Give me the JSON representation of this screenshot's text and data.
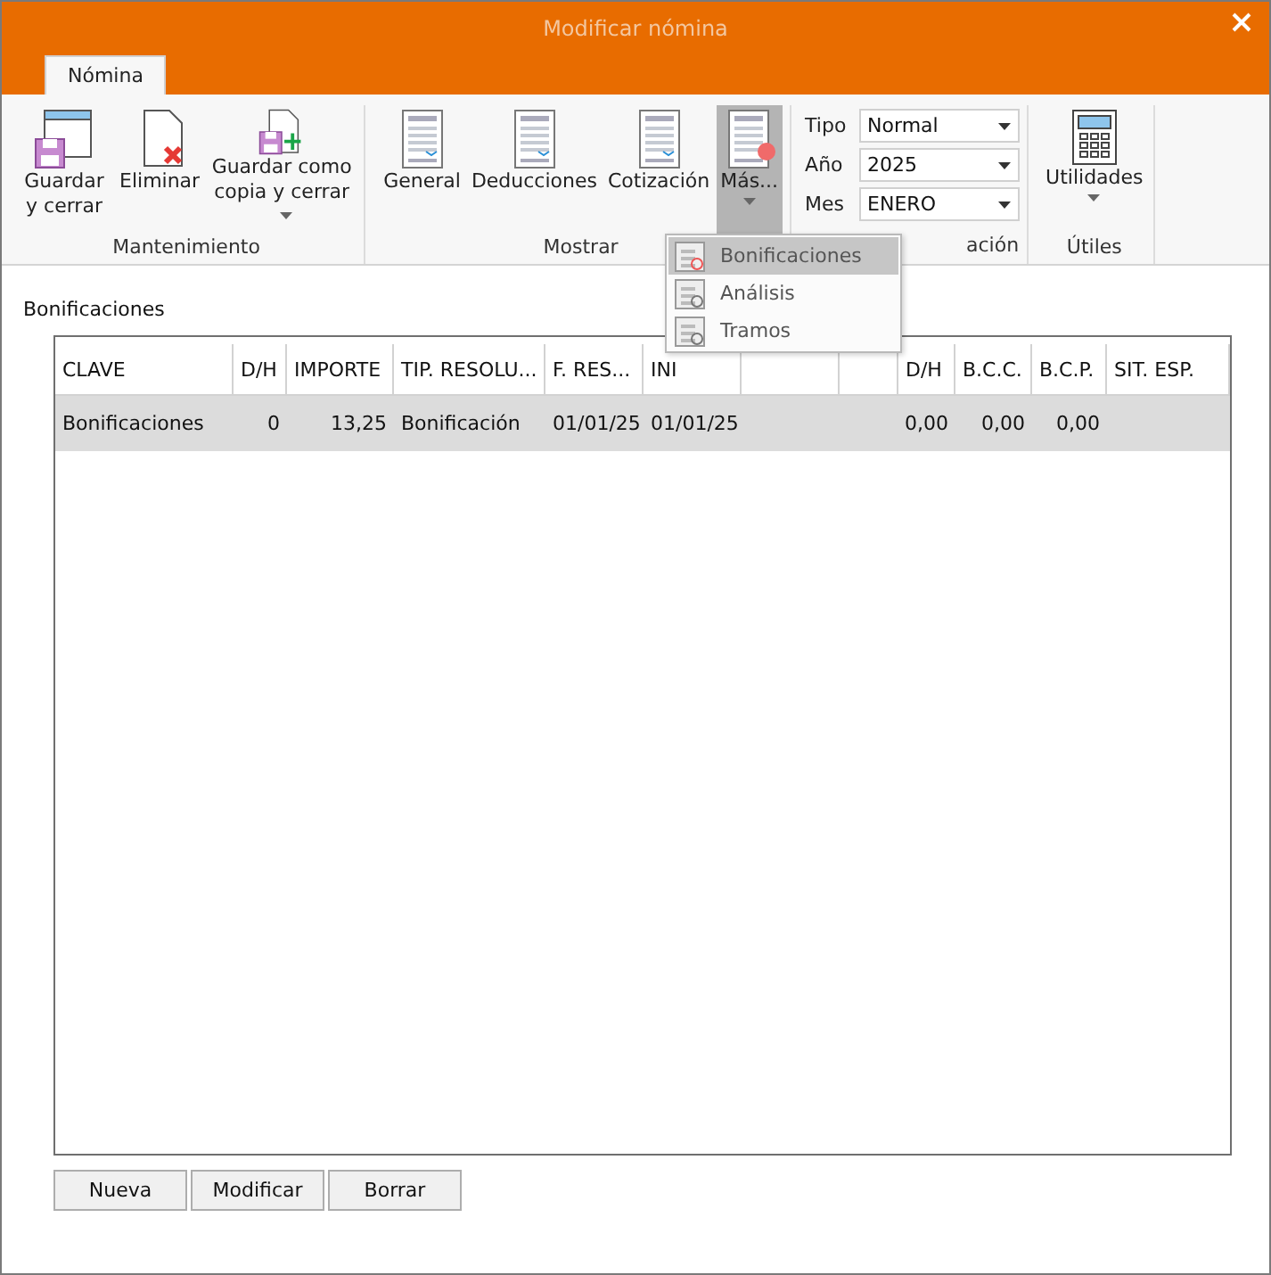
{
  "window": {
    "title": "Modificar nómina"
  },
  "tabs": [
    {
      "label": "Nómina",
      "selected": true
    }
  ],
  "ribbon": {
    "groups": [
      {
        "label": "Mantenimiento",
        "buttons": [
          {
            "label": "Guardar y cerrar",
            "has_menu": false,
            "expanded": false
          },
          {
            "label": "Eliminar",
            "has_menu": false,
            "expanded": false
          },
          {
            "label": "Guardar como copia y cerrar",
            "has_menu": true,
            "expanded": false
          }
        ]
      },
      {
        "label": "Mostrar",
        "buttons": [
          {
            "label": "General",
            "has_menu": false,
            "expanded": false
          },
          {
            "label": "Deducciones",
            "has_menu": false,
            "expanded": false
          },
          {
            "label": "Cotización",
            "has_menu": false,
            "expanded": false
          },
          {
            "label": "Más...",
            "has_menu": true,
            "expanded": true
          }
        ]
      },
      {
        "label": "ación",
        "fields": [
          {
            "label": "Tipo",
            "value": "Normal"
          },
          {
            "label": "Año",
            "value": "2025"
          },
          {
            "label": "Mes",
            "value": "ENERO"
          }
        ]
      },
      {
        "label": "Útiles",
        "buttons": [
          {
            "label": "Utilidades",
            "has_menu": true,
            "expanded": false
          }
        ]
      }
    ]
  },
  "menu": {
    "items": [
      {
        "label": "Bonificaciones",
        "selected": true
      },
      {
        "label": "Análisis",
        "selected": false
      },
      {
        "label": "Tramos",
        "selected": false
      }
    ]
  },
  "section_title": "Bonificaciones",
  "table": {
    "columns": [
      "CLAVE",
      "D/H",
      "IMPORTE",
      "TIP. RESOLU...",
      "F. RES...",
      "INI",
      "",
      "",
      "D/H",
      "B.C.C.",
      "B.C.P.",
      "SIT. ESP."
    ],
    "rows": [
      {
        "selected": true,
        "cells": [
          "Bonificaciones",
          "0",
          "13,25",
          "Bonificación",
          "01/01/25",
          "01/01/25",
          "",
          "",
          "0,00",
          "0,00",
          "0,00",
          ""
        ]
      }
    ]
  },
  "buttons": [
    "Nueva",
    "Modificar",
    "Borrar"
  ]
}
